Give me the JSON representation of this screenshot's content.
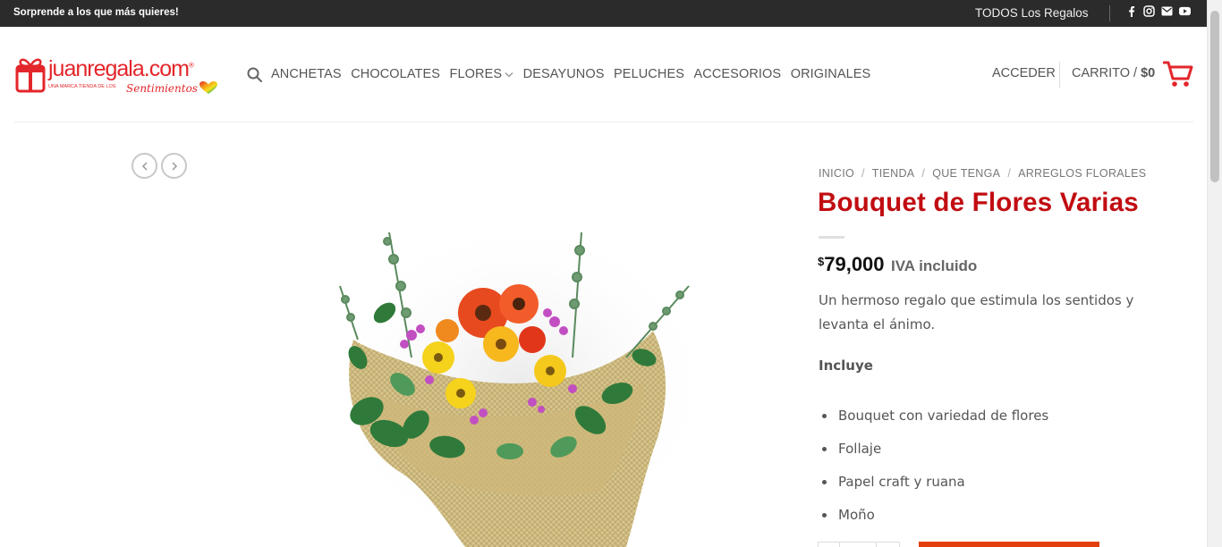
{
  "topbar": {
    "promo": "Sorprende a los que más quieres!",
    "todos_link": "TODOS Los Regalos",
    "social_icons": [
      "facebook-icon",
      "instagram-icon",
      "email-icon",
      "youtube-icon"
    ]
  },
  "logo": {
    "wordmark": "juanregala.com",
    "reg": "®",
    "tagline": "UNA MARCA TIENDA DE LOS",
    "sentimientos": "Sentimientos"
  },
  "nav": {
    "items": [
      "ANCHETAS",
      "CHOCOLATES",
      "FLORES",
      "DESAYUNOS",
      "PELUCHES",
      "ACCESORIOS",
      "ORIGINALES"
    ]
  },
  "account": {
    "login": "ACCEDER"
  },
  "cart": {
    "label": "CARRITO",
    "separator": "/",
    "total": "$0"
  },
  "breadcrumb": [
    "INICIO",
    "TIENDA",
    "QUE TENGA",
    "ARREGLOS FLORALES"
  ],
  "product": {
    "title": "Bouquet de Flores Varias",
    "currency_symbol": "$",
    "price": "79,000",
    "tax_note": "IVA incluido",
    "description": "Un hermoso regalo que estimula los sentidos y levanta el ánimo.",
    "includes_heading": "Incluye",
    "includes": [
      "Bouquet con variedad de flores",
      "Follaje",
      "Papel craft y ruana",
      "Moño"
    ]
  },
  "colors": {
    "brand_red": "#e3262b",
    "title_red": "#c10d12",
    "topbar_bg": "#2b2b2b",
    "add_to_cart": "#e2400f"
  }
}
